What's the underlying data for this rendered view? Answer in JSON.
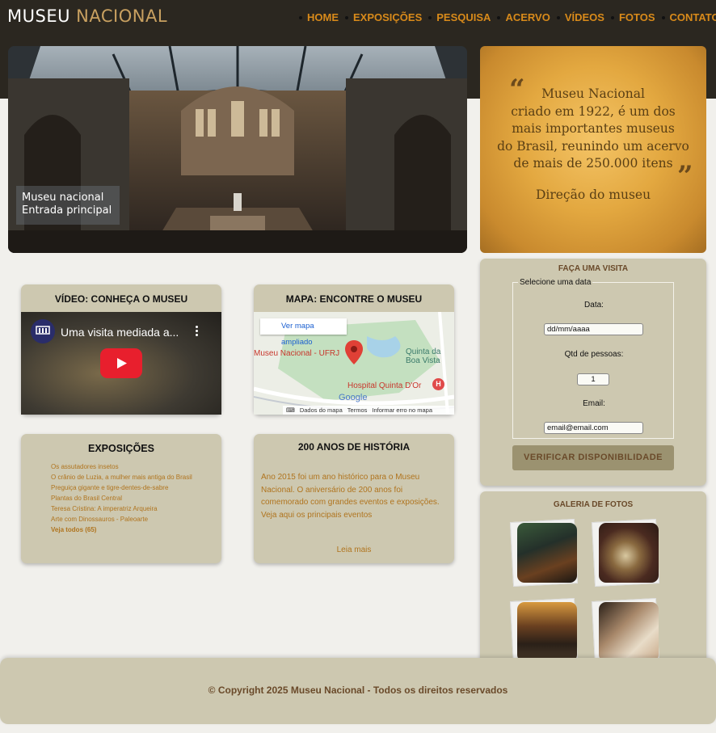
{
  "brand": {
    "name_1": "MUSEU",
    "name_2": "NACIONAL"
  },
  "nav": {
    "items": [
      "HOME",
      "EXPOSIÇÕES",
      "PESQUISA",
      "ACERVO",
      "VÍDEOS",
      "FOTOS",
      "CONTATO"
    ]
  },
  "hero": {
    "caption_1": "Museu nacional",
    "caption_2": "Entrada principal"
  },
  "quote": {
    "open_mark": "“",
    "close_mark": "”",
    "lines": [
      "Museu Nacional",
      "criado em 1922, é um dos",
      "mais importantes museus",
      "do Brasil, reunindo um acervo",
      "de mais de 250.000 itens"
    ],
    "author": "Direção do museu"
  },
  "video_card": {
    "title": "VÍDEO: CONHEÇA O MUSEU",
    "video_title": "Uma visita mediada a...",
    "channel_logo_text": "MUSEU NACIONAL"
  },
  "map_card": {
    "title": "MAPA: ENCONTRE O MUSEU",
    "enlarge_link": "Ver mapa ampliado",
    "place_main": "Museu Nacional - UFRJ",
    "place_2a": "Quinta da",
    "place_2b": "Boa Vista",
    "place_3": "Hospital Quinta D'Or",
    "google": "Google",
    "footer_data": "Dados do mapa",
    "footer_terms": "Termos",
    "footer_report": "Informar erro no mapa"
  },
  "exhibitions_card": {
    "title": "EXPOSIÇÕES",
    "items": [
      "Os assutadores insetos",
      "O crânio de Luzia, a mulher mais antiga do Brasil",
      "Preguiça gigante e tigre-dentes-de-sabre",
      "Plantas do Brasil Central",
      "Teresa Cristina: A imperatriz Arqueira",
      "Arte com Dinossauros - Paleoarte"
    ],
    "see_all": "Veja todos (65)"
  },
  "history_card": {
    "title": "200 ANOS DE HISTÓRIA",
    "text": "Ano 2015 foi um ano histórico para o Museu Nacional. O aniversário de 200 anos foi comemorado com grandes eventos e exposições. Veja aqui os principais eventos",
    "read_more": "Leia mais"
  },
  "visit_form": {
    "title": "FAÇA UMA VISITA",
    "legend": "Selecione uma data",
    "date_label": "Data:",
    "date_placeholder": "dd/mm/aaaa",
    "people_label": "Qtd de pessoas:",
    "people_value": "1",
    "email_label": "Email:",
    "email_placeholder": "email@email.com",
    "submit": "VERIFICAR DISPONIBILIDADE"
  },
  "gallery": {
    "title": "GALERIA DE FOTOS"
  },
  "footer": {
    "copyright": "© Copyright 2025 Museu Nacional - Todos os direitos reservados"
  }
}
